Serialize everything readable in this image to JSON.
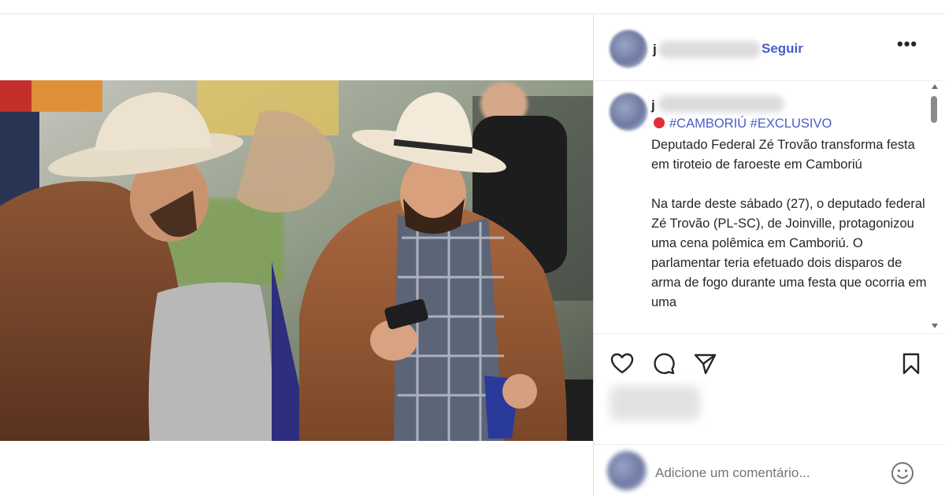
{
  "post": {
    "username_visible": "j",
    "follow_label": "Seguir",
    "more_label": "•••"
  },
  "caption": {
    "author_visible": "j",
    "hashtags": "#CAMBORIÚ #EXCLUSIVO",
    "paragraph1": "Deputado Federal Zé Trovão transforma festa em tiroteio de faroeste em Camboriú",
    "paragraph2": "Na tarde deste sábado (27), o deputado federal Zé Trovão (PL-SC), de Joinville, protagonizou uma cena polêmica em Camboriú. O parlamentar teria efetuado dois disparos de arma de fogo durante uma festa que ocorria em uma"
  },
  "actions": {
    "icons": [
      "heart-icon",
      "comment-icon",
      "share-icon",
      "bookmark-icon"
    ]
  },
  "comment": {
    "placeholder": "Adicione um comentário..."
  },
  "colors": {
    "link_blue": "#4a5cc8",
    "red_dot": "#e02d3b",
    "text": "#262626",
    "muted": "#737373"
  }
}
